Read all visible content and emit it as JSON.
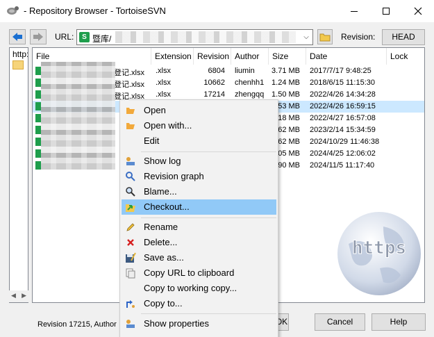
{
  "window": {
    "title": "- Repository Browser - TortoiseSVN"
  },
  "toolbar": {
    "url_label": "URL:",
    "url_value": "暨库/",
    "revision_label": "Revision:",
    "head_button": "HEAD"
  },
  "tree": {
    "root_label": "http:",
    "child_label": ""
  },
  "list": {
    "columns": [
      "File",
      "Extension",
      "Revision",
      "Author",
      "Size",
      "Date",
      "Lock"
    ],
    "rows": [
      {
        "name": "登记.xlsx",
        "ext": ".xlsx",
        "rev": "6804",
        "author": "liumin",
        "size": "3.71 MB",
        "date": "2017/7/17 9:48:25"
      },
      {
        "name": "登记.xlsx",
        "ext": ".xlsx",
        "rev": "10662",
        "author": "chenhh1",
        "size": "1.24 MB",
        "date": "2018/6/15 11:15:30"
      },
      {
        "name": "登记.xlsx",
        "ext": ".xlsx",
        "rev": "17214",
        "author": "zhengqq",
        "size": "1.50 MB",
        "date": "2022/4/26 14:34:28"
      },
      {
        "name": "",
        "ext": "",
        "rev": "",
        "author": "",
        "size": ".53 MB",
        "date": "2022/4/26 16:59:15"
      },
      {
        "name": "",
        "ext": "",
        "rev": "",
        "author": "",
        "size": ".18 MB",
        "date": "2022/4/27 16:57:08"
      },
      {
        "name": "",
        "ext": "",
        "rev": "",
        "author": "",
        "size": ".62 MB",
        "date": "2023/2/14 15:34:59"
      },
      {
        "name": "",
        "ext": "",
        "rev": "",
        "author": "",
        "size": ".62 MB",
        "date": "2024/10/29 11:46:38"
      },
      {
        "name": "",
        "ext": "",
        "rev": "",
        "author": "",
        "size": ".05 MB",
        "date": "2024/4/25 12:06:02"
      },
      {
        "name": "",
        "ext": "",
        "rev": "",
        "author": "",
        "size": ".90 MB",
        "date": "2024/11/5 11:17:40"
      }
    ]
  },
  "context_menu": {
    "items": [
      {
        "label": "Open",
        "icon": "open-folder-icon"
      },
      {
        "label": "Open with...",
        "icon": "open-with-icon"
      },
      {
        "label": "Edit",
        "icon": ""
      },
      {
        "label": "Show log",
        "icon": "show-log-icon"
      },
      {
        "label": "Revision graph",
        "icon": "revision-graph-icon"
      },
      {
        "label": "Blame...",
        "icon": "blame-icon"
      },
      {
        "label": "Checkout...",
        "icon": "checkout-icon"
      },
      {
        "label": "Rename",
        "icon": "rename-pencil-icon"
      },
      {
        "label": "Delete...",
        "icon": "delete-x-icon"
      },
      {
        "label": "Save as...",
        "icon": "save-as-icon"
      },
      {
        "label": "Copy URL to clipboard",
        "icon": "copy-url-icon"
      },
      {
        "label": "Copy to working copy...",
        "icon": ""
      },
      {
        "label": "Copy to...",
        "icon": "copy-to-icon"
      },
      {
        "label": "Show properties",
        "icon": "properties-icon"
      }
    ]
  },
  "status": {
    "text": "Revision 17215, Author"
  },
  "buttons": {
    "ok": "OK",
    "cancel": "Cancel",
    "help": "Help"
  },
  "watermark": {
    "text": "https"
  }
}
